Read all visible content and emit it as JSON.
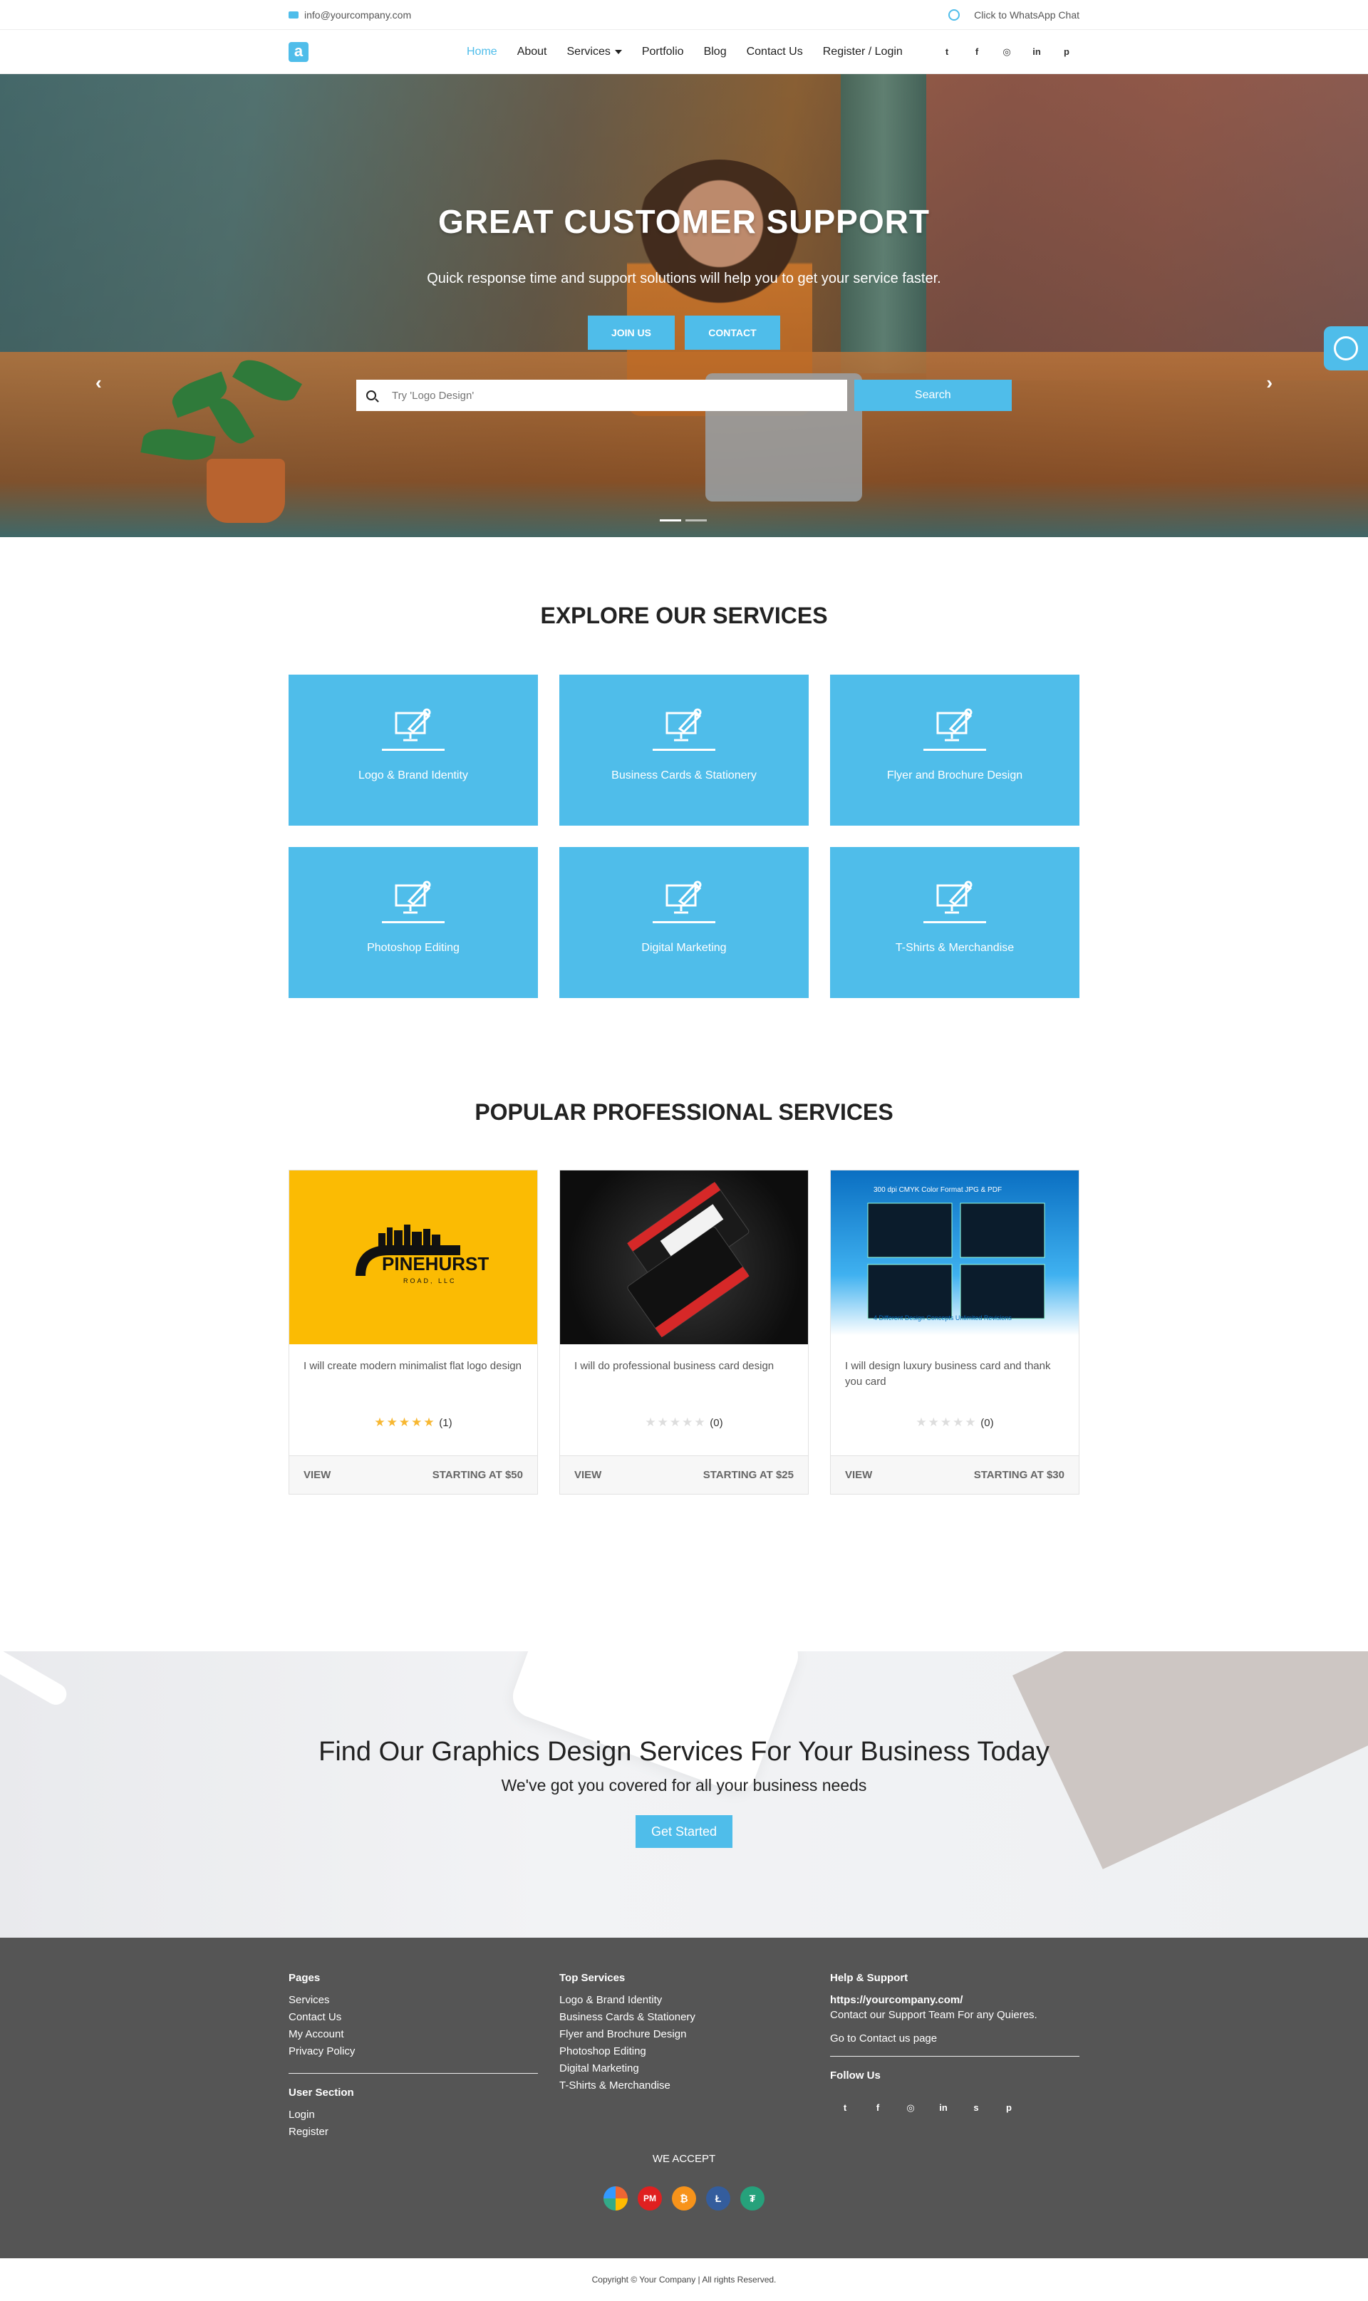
{
  "topbar": {
    "email": "info@yourcompany.com",
    "whatsapp": "Click to WhatsApp Chat"
  },
  "nav": {
    "logo": "a",
    "items": [
      "Home",
      "About",
      "Services",
      "Portfolio",
      "Blog",
      "Contact Us",
      "Register / Login"
    ],
    "social_icons": [
      "twitter-icon",
      "facebook-icon",
      "instagram-icon",
      "linkedin-icon",
      "pinterest-icon"
    ]
  },
  "hero": {
    "title": "GREAT CUSTOMER SUPPORT",
    "subtitle": "Quick response time and support solutions will help you to get your service faster.",
    "btn_join": "JOIN US",
    "btn_contact": "CONTACT",
    "search_placeholder": "Try 'Logo Design'",
    "search_button": "Search",
    "active_slide": 1,
    "slide_count": 2
  },
  "services": {
    "title": "EXPLORE OUR SERVICES",
    "items": [
      "Logo & Brand Identity",
      "Business Cards & Stationery",
      "Flyer and Brochure Design",
      "Photoshop Editing",
      "Digital Marketing",
      "T-Shirts & Merchandise"
    ]
  },
  "popular": {
    "title": "POPULAR PROFESSIONAL SERVICES",
    "cards": [
      {
        "title": "I will create modern minimalist flat logo design",
        "rating": 5,
        "count": "(1)",
        "view": "VIEW",
        "price": "STARTING AT $50",
        "image_text": "PINEHURST",
        "image_sub": "ROAD, LLC"
      },
      {
        "title": "I will do professional business card design",
        "rating": 0,
        "count": "(0)",
        "view": "VIEW",
        "price": "STARTING AT $25"
      },
      {
        "title": "I will design luxury business card and thank you card",
        "rating": 0,
        "count": "(0)",
        "view": "VIEW",
        "price": "STARTING AT $30",
        "image_top": "300 dpi CMYK Color Format JPG & PDF",
        "image_bottom": "4 Different Design Concepts  Unlimited Revisions"
      }
    ]
  },
  "cta": {
    "title": "Find Our Graphics Design Services For Your Business Today",
    "subtitle": "We've got you covered for all your business needs",
    "button": "Get Started"
  },
  "footer": {
    "pages_title": "Pages",
    "pages": [
      "Services",
      "Contact Us",
      "My Account",
      "Privacy Policy"
    ],
    "user_title": "User Section",
    "user": [
      "Login",
      "Register"
    ],
    "top_title": "Top Services",
    "top": [
      "Logo & Brand Identity",
      "Business Cards & Stationery",
      "Flyer and Brochure Design",
      "Photoshop Editing",
      "Digital Marketing",
      "T-Shirts & Merchandise"
    ],
    "help_title": "Help & Support",
    "site": "https://yourcompany.com/",
    "help_text": "Contact our Support Team For any Quieres.",
    "help_link": "Go to Contact us page",
    "follow_title": "Follow Us",
    "accept": "WE ACCEPT",
    "payments": [
      "PM"
    ]
  },
  "copyright": "Copyright © Your Company | All rights Reserved."
}
